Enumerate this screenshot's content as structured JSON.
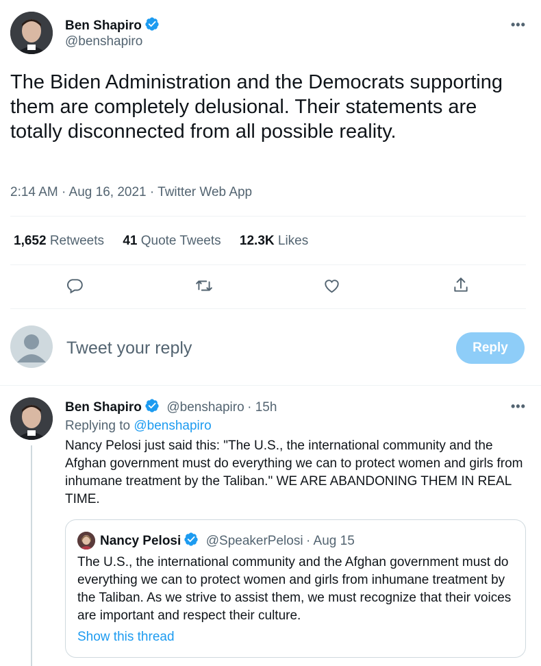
{
  "main_tweet": {
    "author_name": "Ben Shapiro",
    "author_handle": "@benshapiro",
    "more_icon": "more-dots-icon",
    "text": "The Biden Administration and the Democrats supporting them are completely delusional. Their statements are totally disconnected from all possible reality.",
    "timestamp": "2:14 AM · Aug 16, 2021 · Twitter Web App",
    "stats": {
      "retweets_count": "1,652",
      "retweets_label": "Retweets",
      "quotes_count": "41",
      "quotes_label": "Quote Tweets",
      "likes_count": "12.3K",
      "likes_label": "Likes"
    },
    "actions": [
      "reply-icon",
      "retweet-icon",
      "like-icon",
      "share-icon"
    ]
  },
  "composer": {
    "placeholder": "Tweet your reply",
    "reply_button": "Reply"
  },
  "reply_tweet": {
    "author_name": "Ben Shapiro",
    "author_handle": "@benshapiro",
    "time": "· 15h",
    "replying_prefix": "Replying to",
    "replying_handle": "@benshapiro",
    "text": "Nancy Pelosi just said this: \"The U.S., the international community and the Afghan government must do everything we can to protect women and girls from inhumane treatment by the Taliban.\" WE ARE ABANDONING THEM IN REAL TIME.",
    "quoted": {
      "author_name": "Nancy Pelosi",
      "author_handle": "@SpeakerPelosi",
      "time": "· Aug 15",
      "text": "The U.S., the international community and the Afghan government must do everything we can to protect women and girls from inhumane treatment by the Taliban. As we strive to assist them, we must recognize that their voices are important and respect their culture.",
      "show_thread": "Show this thread"
    }
  },
  "colors": {
    "accent": "#1d9bf0",
    "reply_button_disabled": "#8ecdf8",
    "secondary_text": "#536471",
    "divider": "#eff3f4"
  }
}
